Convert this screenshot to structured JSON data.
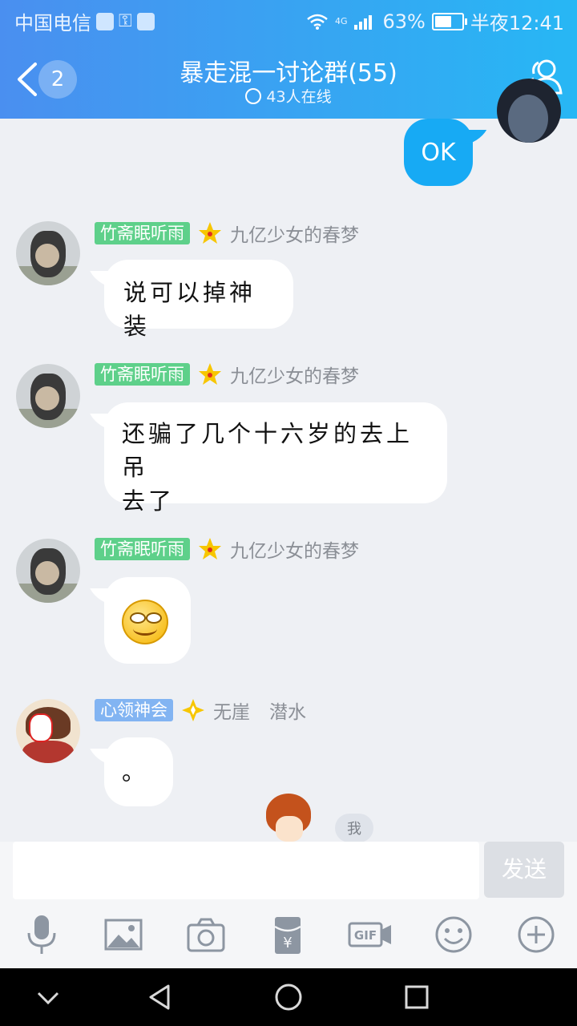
{
  "status_bar": {
    "carrier": "中国电信",
    "network": "4G",
    "battery": "63%",
    "battery_level": 0.63,
    "time": "半夜12:41"
  },
  "header": {
    "back_badge": "2",
    "title": "暴走混一讨论群(55)",
    "subtitle": "43人在线"
  },
  "messages": [
    {
      "sender": "me",
      "text": "OK"
    },
    {
      "tag": "竹斋眠听雨",
      "nickname": "九亿少女的春梦",
      "text": "说可以掉神装"
    },
    {
      "tag": "竹斋眠听雨",
      "nickname": "九亿少女的春梦",
      "line1": "还骗了几个十六岁的去上吊",
      "line2": "去了"
    },
    {
      "tag": "竹斋眠听雨",
      "nickname": "九亿少女的春梦",
      "emoji": "smirk-emoji"
    },
    {
      "tag": "心领神会",
      "nickname": "无崖",
      "role": "潜水",
      "text": "。"
    }
  ],
  "me_tag": "我",
  "composer": {
    "placeholder": "",
    "send_label": "发送"
  },
  "toolbar": [
    "microphone-icon",
    "image-icon",
    "camera-icon",
    "red-packet-icon",
    "gif-icon",
    "emoji-icon",
    "plus-icon"
  ],
  "colors": {
    "header_start": "#4a8ff0",
    "header_end": "#27b7f4",
    "my_bubble": "#17aaf4",
    "tag_green": "#5ed08a",
    "tag_blue": "#82b4f2"
  }
}
